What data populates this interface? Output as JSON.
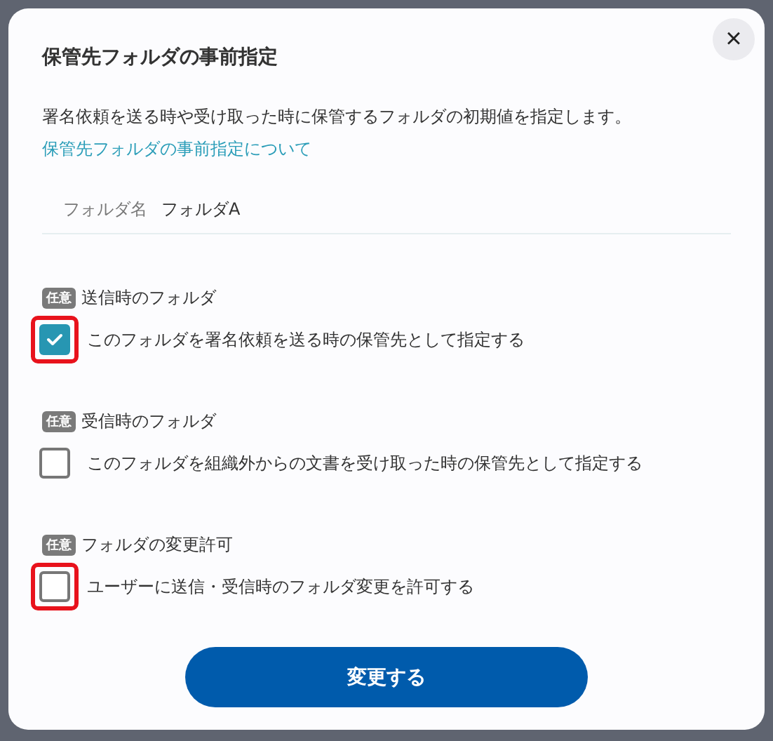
{
  "dialog": {
    "title": "保管先フォルダの事前指定",
    "close_label": "×",
    "description": "署名依頼を送る時や受け取った時に保管するフォルダの初期値を指定します。",
    "help_link": "保管先フォルダの事前指定について",
    "folder_field": {
      "label": "フォルダ名",
      "value": "フォルダA"
    },
    "sections": [
      {
        "badge": "任意",
        "heading": "送信時のフォルダ",
        "option": "このフォルダを署名依頼を送る時の保管先として指定する",
        "checked": true,
        "highlighted": true
      },
      {
        "badge": "任意",
        "heading": "受信時のフォルダ",
        "option": "このフォルダを組織外からの文書を受け取った時の保管先として指定する",
        "checked": false,
        "highlighted": false
      },
      {
        "badge": "任意",
        "heading": "フォルダの変更許可",
        "option": "ユーザーに送信・受信時のフォルダ変更を許可する",
        "checked": false,
        "highlighted": true
      }
    ],
    "submit": "変更する"
  }
}
